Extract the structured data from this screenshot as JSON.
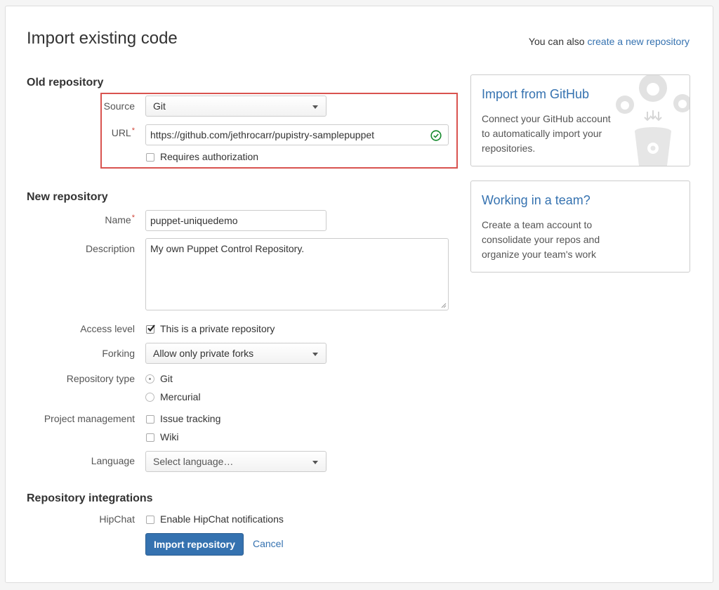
{
  "header": {
    "title": "Import existing code",
    "also_text": "You can also",
    "also_link": "create a new repository"
  },
  "old_repo": {
    "heading": "Old repository",
    "source_label": "Source",
    "source_value": "Git",
    "url_label": "URL",
    "url_value": "https://github.com/jethrocarr/pupistry-samplepuppet",
    "requires_auth": "Requires authorization"
  },
  "new_repo": {
    "heading": "New repository",
    "name_label": "Name",
    "name_value": "puppet-uniquedemo",
    "description_label": "Description",
    "description_value": "My own Puppet Control Repository.",
    "access_label": "Access level",
    "access_option": "This is a private repository",
    "forking_label": "Forking",
    "forking_value": "Allow only private forks",
    "repo_type_label": "Repository type",
    "repo_type_git": "Git",
    "repo_type_hg": "Mercurial",
    "pm_label": "Project management",
    "pm_issue": "Issue tracking",
    "pm_wiki": "Wiki",
    "language_label": "Language",
    "language_value": "Select language…"
  },
  "integrations": {
    "heading": "Repository integrations",
    "hipchat_label": "HipChat",
    "hipchat_option": "Enable HipChat notifications"
  },
  "actions": {
    "import_button": "Import repository",
    "cancel": "Cancel"
  },
  "cards": {
    "github_title": "Import from GitHub",
    "github_text": "Connect your GitHub account to automatically import your repositories.",
    "team_title": "Working in a team?",
    "team_text": "Create a team account to consolidate your repos and organize your team's work"
  },
  "colors": {
    "link": "#3572b0",
    "highlight": "#d9534f",
    "primary_button": "#3572b0",
    "valid": "#14892c"
  },
  "state": {
    "access_private": true,
    "requires_auth": false,
    "repo_type": "Git",
    "issue_tracking": false,
    "wiki": false,
    "hipchat": false,
    "url_valid": true
  },
  "icons": [
    "select-caret-icon",
    "check-circle-icon",
    "github-octocat-icon",
    "download-arrows-icon",
    "bucket-icon"
  ]
}
